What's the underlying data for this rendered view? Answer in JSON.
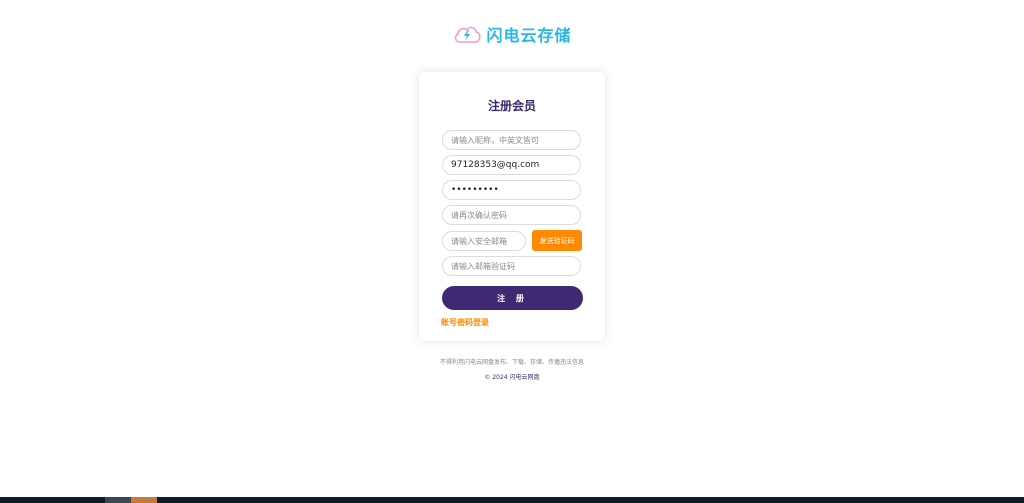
{
  "brand": {
    "name": "闪电云存储"
  },
  "form": {
    "title": "注册会员",
    "nickname_placeholder": "请输入昵称，中英文皆可",
    "email_value": "97128353@qq.com",
    "password_value": "•••••••••",
    "confirm_placeholder": "请再次确认密码",
    "safe_email_placeholder": "请输入安全邮箱",
    "send_code_label": "发送验证码",
    "code_placeholder": "请输入邮箱验证码",
    "register_label": "注 册",
    "login_link": "账号密码登录"
  },
  "footer": {
    "note": "不得利用闪电云网盘发布、下载、存储、传播违法信息",
    "copyright": "© 2024 闪电云网盘"
  },
  "colors": {
    "brand": "#27b7e8",
    "primary": "#3e2a73",
    "accent": "#ff8a00"
  }
}
